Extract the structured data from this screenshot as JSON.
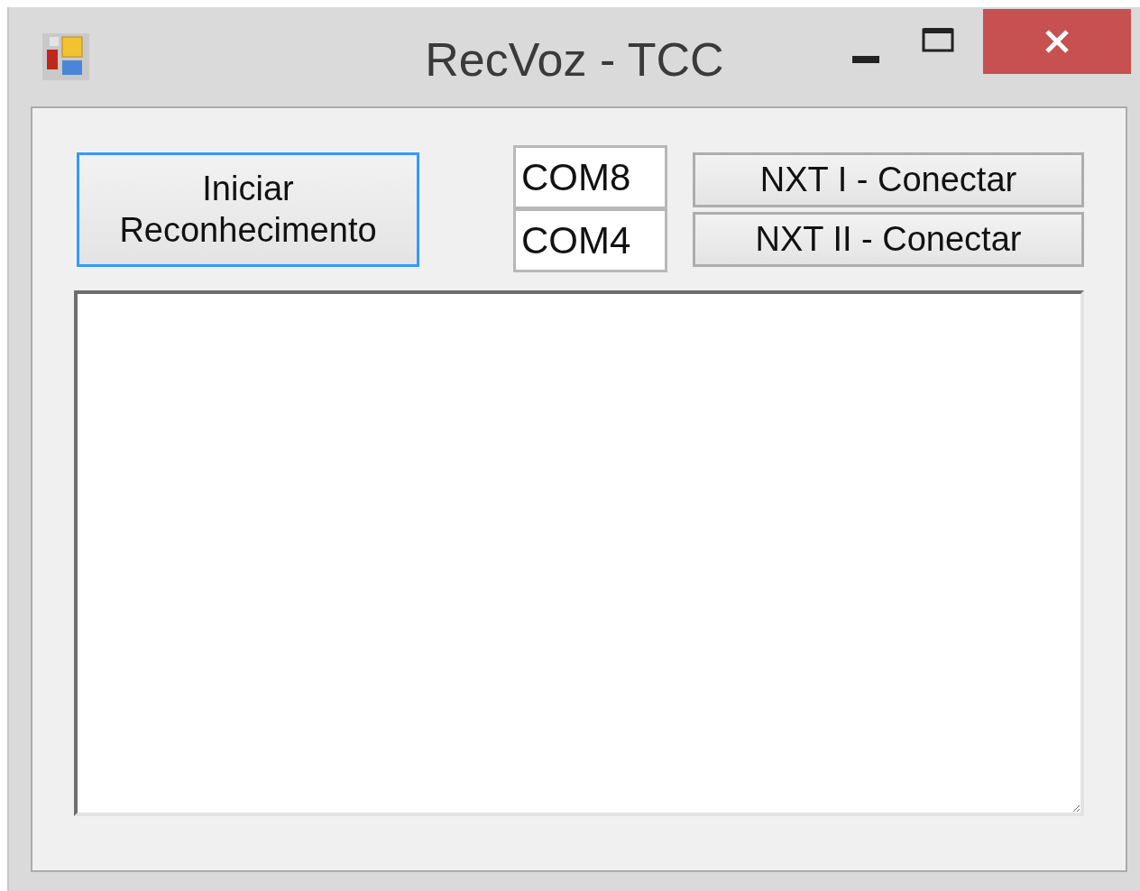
{
  "window": {
    "title": "RecVoz - TCC"
  },
  "start_button": {
    "label": "Iniciar Reconhecimento",
    "focused": true
  },
  "ports": [
    {
      "value": "COM8"
    },
    {
      "value": "COM4"
    }
  ],
  "connect_buttons": [
    {
      "label": "NXT I - Conectar"
    },
    {
      "label": "NXT II - Conectar"
    }
  ]
}
